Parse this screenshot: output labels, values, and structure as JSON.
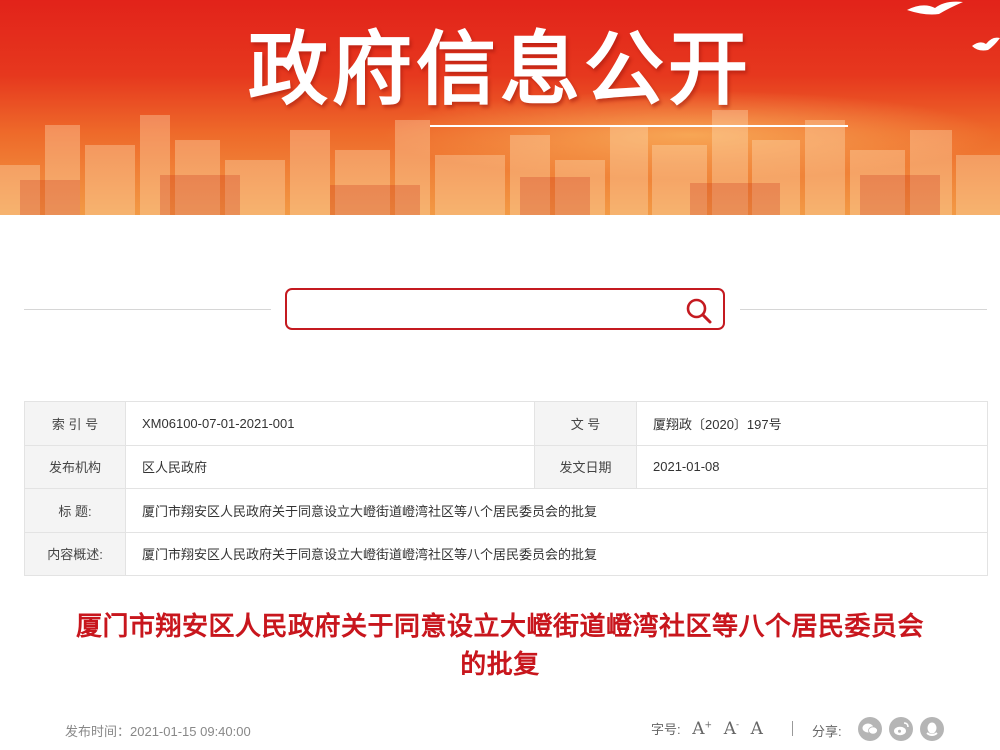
{
  "banner": {
    "title": "政府信息公开"
  },
  "search": {
    "placeholder": ""
  },
  "meta": {
    "index_label": "索 引 号",
    "index_value": "XM06100-07-01-2021-001",
    "doc_no_label": "文 号",
    "doc_no_value": "厦翔政〔2020〕197号",
    "issuer_label": "发布机构",
    "issuer_value": "区人民政府",
    "issue_date_label": "发文日期",
    "issue_date_value": "2021-01-08",
    "title_label": "标 题:",
    "title_value": "厦门市翔安区人民政府关于同意设立大嶝街道嶝湾社区等八个居民委员会的批复",
    "summary_label": "内容概述:",
    "summary_value": "厦门市翔安区人民政府关于同意设立大嶝街道嶝湾社区等八个居民委员会的批复"
  },
  "article": {
    "title_line1": "厦门市翔安区人民政府关于同意设立大嶝街道嶝湾社区等八个居民委员会",
    "title_line2": "的批复",
    "publish_time": "发布时间：2021-01-15 09:40:00"
  },
  "toolbar": {
    "font_size_label": "字号:",
    "font_large": "A",
    "font_medium": "A",
    "font_small": "A",
    "share_label": "分享:"
  },
  "icons": {
    "search": "search-icon",
    "wechat": "wechat-icon",
    "weibo": "weibo-icon",
    "qq": "qq-icon"
  },
  "colors": {
    "accent": "#c8161d",
    "banner_top": "#e2231a",
    "banner_bottom": "#f29a45",
    "table_label_bg": "#f4f4f4"
  }
}
